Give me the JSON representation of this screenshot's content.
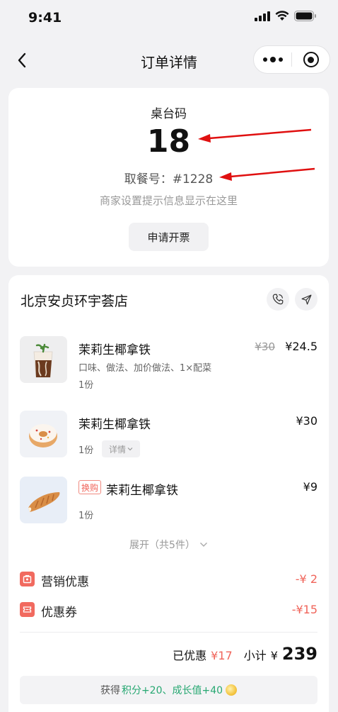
{
  "status_bar": {
    "time": "9:41"
  },
  "nav": {
    "title": "订单详情"
  },
  "order_card": {
    "table_label": "桌台码",
    "table_number": "18",
    "pickup": "取餐号：#1228",
    "hint": "商家设置提示信息显示在这里",
    "invoice_button": "申请开票"
  },
  "store": {
    "name": "北京安贞环宇荟店",
    "items": [
      {
        "name": "茉莉生椰拿铁",
        "original_price": "¥30",
        "price": "¥24.5",
        "spec": "口味、做法、加价做法、1×配菜",
        "qty": "1份"
      },
      {
        "name": "茉莉生椰拿铁",
        "price": "¥30",
        "qty": "1份",
        "detail_label": "详情"
      },
      {
        "name": "茉莉生椰拿铁",
        "tag": "换购",
        "price": "¥9",
        "qty": "1份"
      }
    ],
    "expand_label": "展开（共5件）"
  },
  "discounts": [
    {
      "label": "营销优惠",
      "value": "-¥ 2",
      "icon": "promo-icon"
    },
    {
      "label": "优惠券",
      "value": "-¥15",
      "icon": "coupon-icon"
    }
  ],
  "totals": {
    "discount_label": "已优惠",
    "discount_value": "¥17",
    "subtotal_label": "小计",
    "subtotal_currency": "¥",
    "subtotal_value": "239"
  },
  "reward": {
    "prefix": "获得",
    "highlight": "积分+20、成长值+40"
  },
  "colors": {
    "accent_red": "#f0645a",
    "reward_green": "#27a872",
    "annotation_arrow": "#e01010"
  }
}
